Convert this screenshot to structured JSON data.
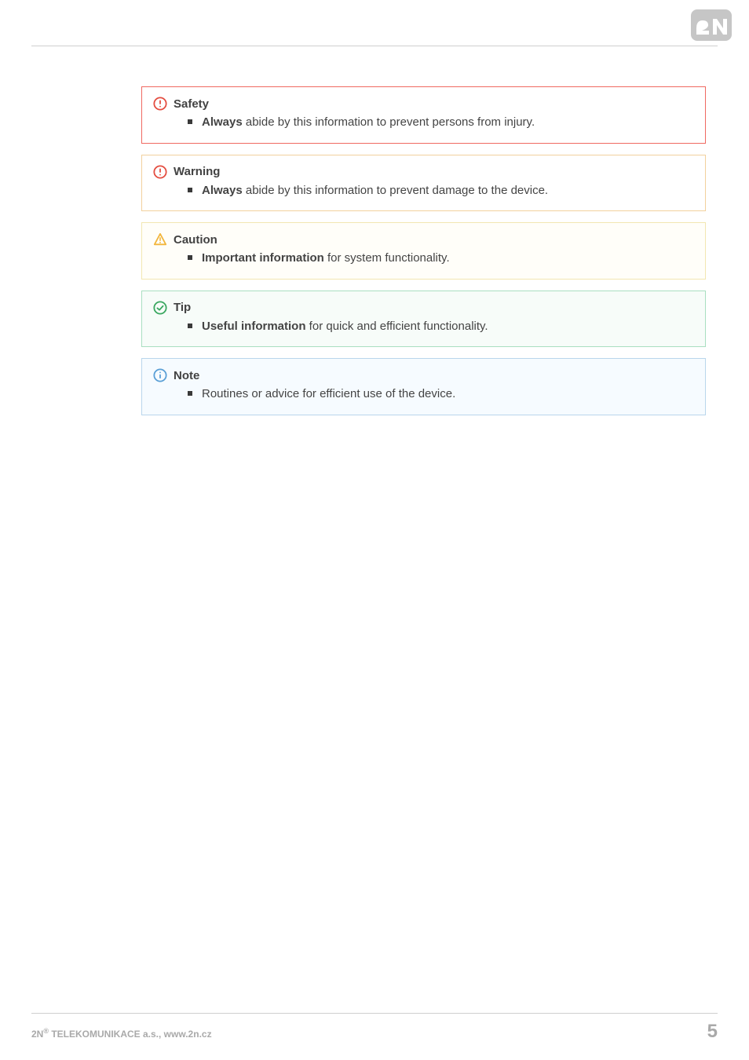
{
  "header": {
    "logo_label": "2N"
  },
  "panels": {
    "safety": {
      "title": "Safety",
      "bullet_strong": "Always ",
      "bullet_rest": " abide by this information to prevent persons from injury."
    },
    "warning": {
      "title": "Warning",
      "bullet_strong": "Always",
      "bullet_rest": " abide by this information to prevent damage to the device."
    },
    "caution": {
      "title": "Caution",
      "bullet_strong": "Important information",
      "bullet_rest": " for system functionality."
    },
    "tip": {
      "title": "Tip",
      "bullet_strong": "Useful information",
      "bullet_rest": " for quick and efficient functionality."
    },
    "note": {
      "title": "Note",
      "bullet_strong": "",
      "bullet_rest": "Routines or advice for efficient use of the device."
    }
  },
  "footer": {
    "prefix": "2N",
    "sup": "®",
    "company": " TELEKOMUNIKACE a.s., www.2n.cz",
    "page_number": "5"
  }
}
